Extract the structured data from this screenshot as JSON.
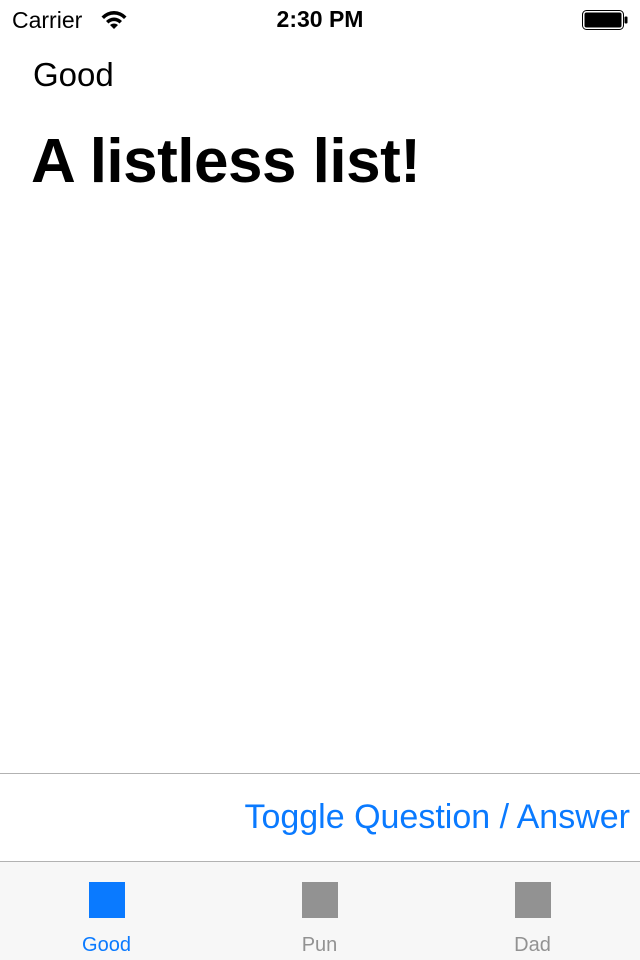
{
  "status_bar": {
    "carrier": "Carrier",
    "time": "2:30 PM",
    "wifi_icon": "wifi-icon",
    "battery_icon": "battery-icon"
  },
  "content": {
    "category": "Good",
    "question": "A listless list!"
  },
  "toolbar": {
    "toggle_label": "Toggle Question / Answer"
  },
  "tab_bar": {
    "selected": "Good",
    "tabs": [
      {
        "label": "Good",
        "icon": "square-icon"
      },
      {
        "label": "Pun",
        "icon": "square-icon"
      },
      {
        "label": "Dad",
        "icon": "square-icon"
      }
    ]
  },
  "colors": {
    "accent": "#0a7aff",
    "inactive": "#929292",
    "tab_bar_bg": "#f7f7f7"
  }
}
